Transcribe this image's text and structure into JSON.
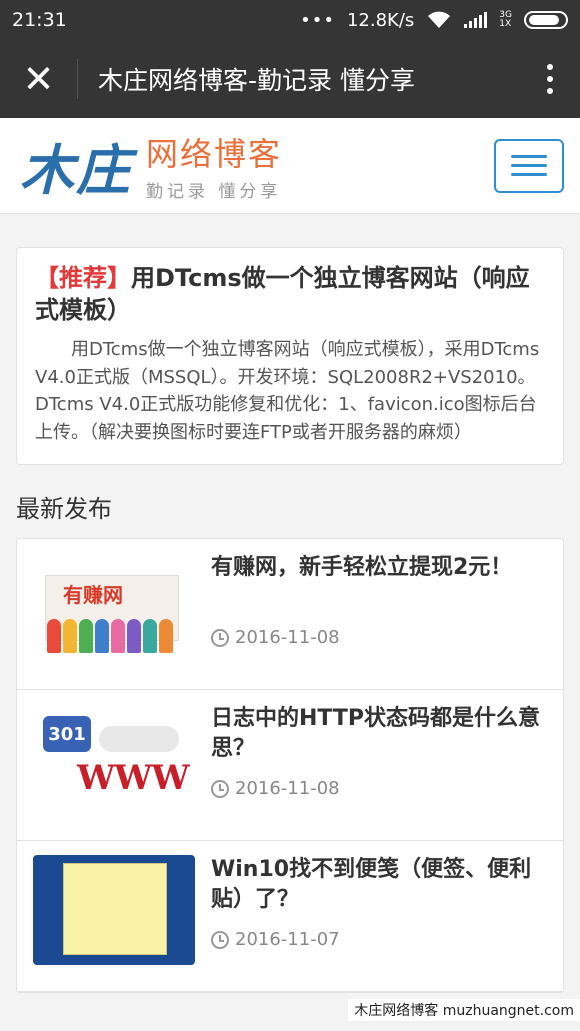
{
  "status_bar": {
    "time": "21:31",
    "network_speed": "12.8K/s",
    "network_type": "3G",
    "network_slot": "1X"
  },
  "title_bar": {
    "title": "木庄网络博客-勤记录 懂分享",
    "close_label": "✕"
  },
  "site_header": {
    "logo_mark": "木庄",
    "logo_main": "网络博客",
    "logo_sub": "勤记录 懂分享"
  },
  "featured": {
    "tag": "【推荐】",
    "title": "用DTcms做一个独立博客网站（响应式模板）",
    "description": "用DTcms做一个独立博客网站（响应式模板），采用DTcms V4.0正式版（MSSQL）。开发环境：SQL2008R2+VS2010。DTcms V4.0正式版功能修复和优化：1、favicon.ico图标后台上传。（解决要换图标时要连FTP或者开服务器的麻烦）"
  },
  "latest": {
    "heading": "最新发布",
    "posts": [
      {
        "title": "有赚网，新手轻松立提现2元！",
        "date": "2016-11-08",
        "thumb_text": "有赚网"
      },
      {
        "title": "日志中的HTTP状态码都是什么意思？",
        "date": "2016-11-08",
        "thumb_text": "301",
        "thumb_text2": "WWW"
      },
      {
        "title": "Win10找不到便笺（便签、便利贴）了？",
        "date": "2016-11-07"
      }
    ]
  },
  "watermark": "木庄网络博客 muzhuangnet.com",
  "colors": {
    "accent": "#2f8ed0",
    "tag_red": "#e03a3a",
    "logo_orange": "#e9703a",
    "bar_bg": "#353535"
  }
}
